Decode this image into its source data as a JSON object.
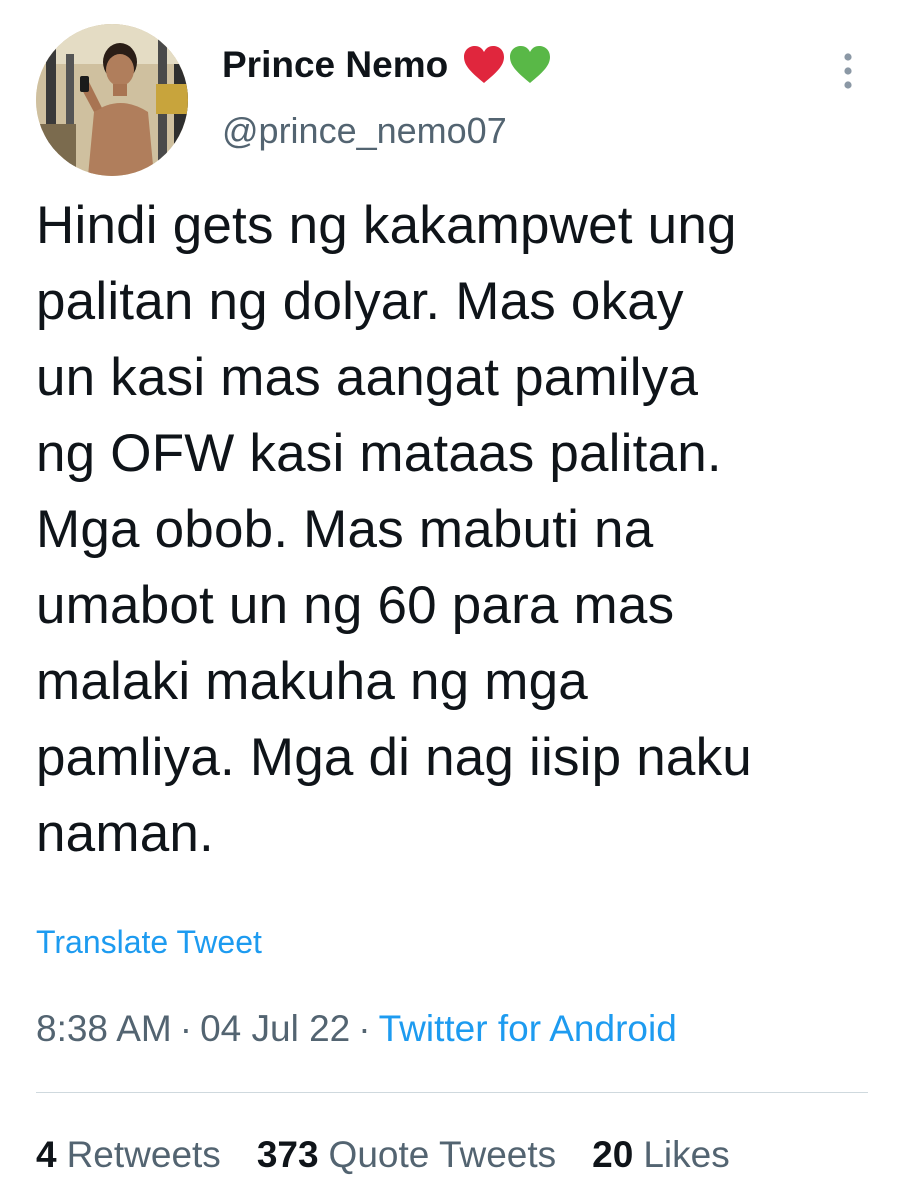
{
  "tweet": {
    "author_name": "Prince Nemo",
    "author_handle": "@prince_nemo07",
    "name_emojis": [
      "red-heart",
      "green-heart"
    ],
    "text_lines": [
      "Hindi gets ng kakampwet ung",
      "palitan ng dolyar. Mas okay",
      "un kasi mas aangat pamilya",
      "ng OFW kasi mataas palitan.",
      "Mga obob. Mas mabuti na",
      "umabot un ng 60 para mas",
      "malaki makuha ng mga",
      "pamliya. Mga di nag iisip naku",
      "naman."
    ],
    "translate_label": "Translate Tweet",
    "time": "8:38 AM",
    "date": "04 Jul 22",
    "separator": "·",
    "source": "Twitter for Android"
  },
  "stats": [
    {
      "count": "4",
      "label": "Retweets"
    },
    {
      "count": "373",
      "label": "Quote Tweets"
    },
    {
      "count": "20",
      "label": "Likes"
    }
  ],
  "colors": {
    "link": "#1d9bf0",
    "secondary_text": "#536471",
    "primary_text": "#0f1419",
    "divider": "#cfd9de",
    "red_heart": "#e0263d",
    "green_heart": "#59b847"
  },
  "icons": {
    "more": "more-vertical-icon"
  }
}
